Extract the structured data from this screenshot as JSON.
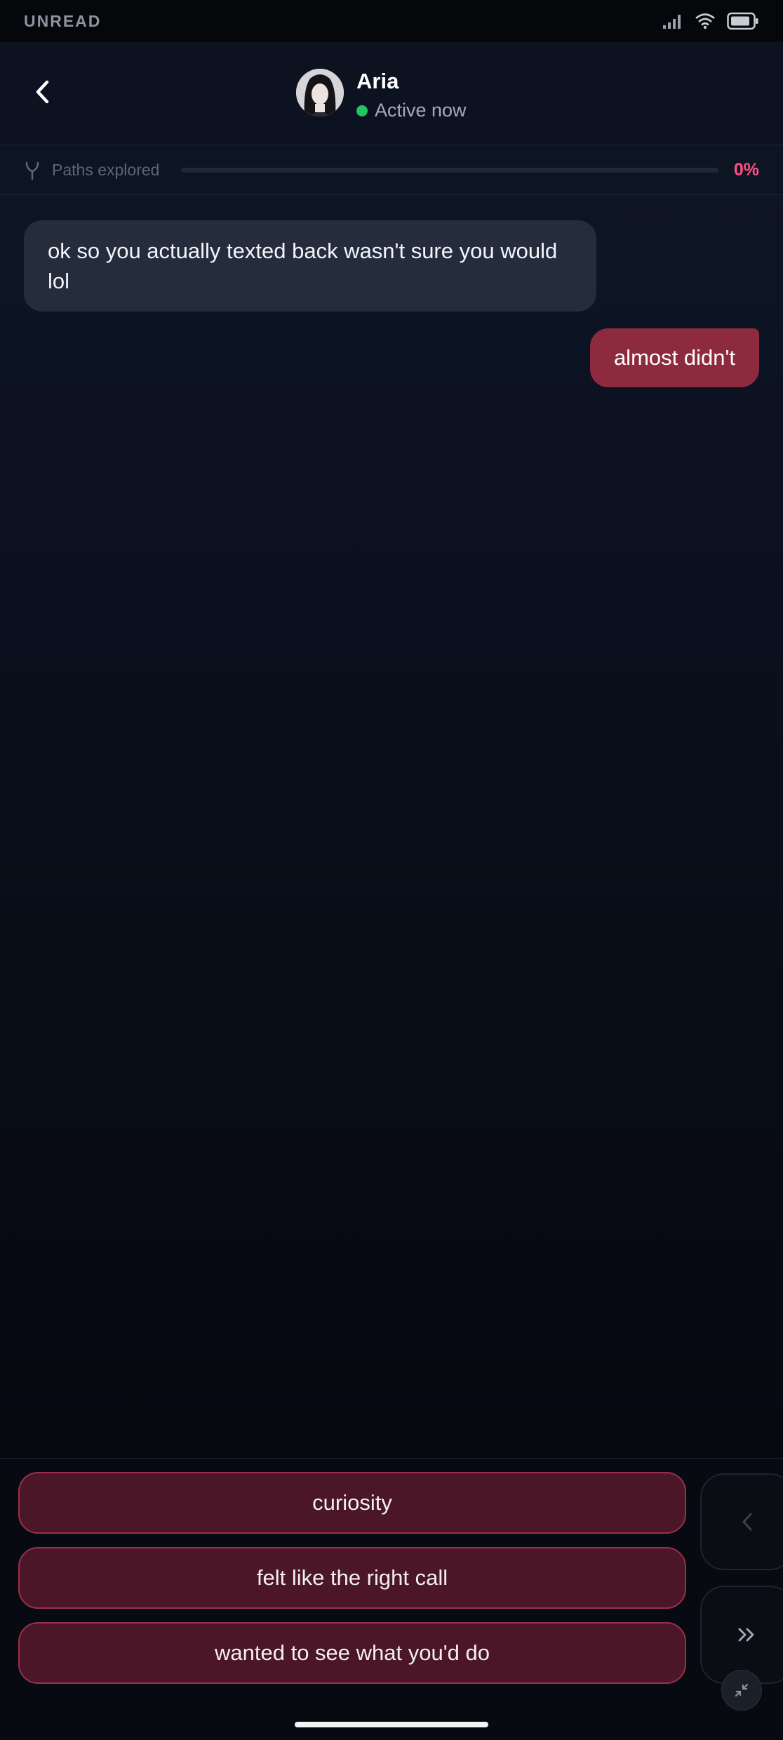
{
  "status_bar": {
    "app_label": "UNREAD",
    "icons": [
      "signal-icon",
      "wifi-icon",
      "battery-icon"
    ]
  },
  "header": {
    "back_icon": "chevron-left-icon",
    "contact": {
      "name": "Aria",
      "presence": "Active now",
      "presence_color": "#22c55e"
    }
  },
  "progress": {
    "icon": "branch-icon",
    "label": "Paths explored",
    "value_text": "0%",
    "fraction": 0,
    "accent": "#ff4f86"
  },
  "messages": [
    {
      "sender": "contact",
      "text": "ok so you actually texted back wasn't sure you would lol"
    },
    {
      "sender": "user",
      "text": "almost didn't"
    }
  ],
  "choices": [
    {
      "label": "curiosity"
    },
    {
      "label": "felt like the right call"
    },
    {
      "label": "wanted to see what you'd do"
    }
  ],
  "controls": {
    "prev_icon": "chevron-left-icon",
    "skip_icon": "double-chevron-right-icon",
    "collapse_icon": "collapse-arrows-icon"
  },
  "colors": {
    "incoming_bubble": "#252d3d",
    "outgoing_bubble": "#8e2a3e",
    "choice_fill": "#4a1628",
    "choice_border": "#9b2e4d"
  }
}
